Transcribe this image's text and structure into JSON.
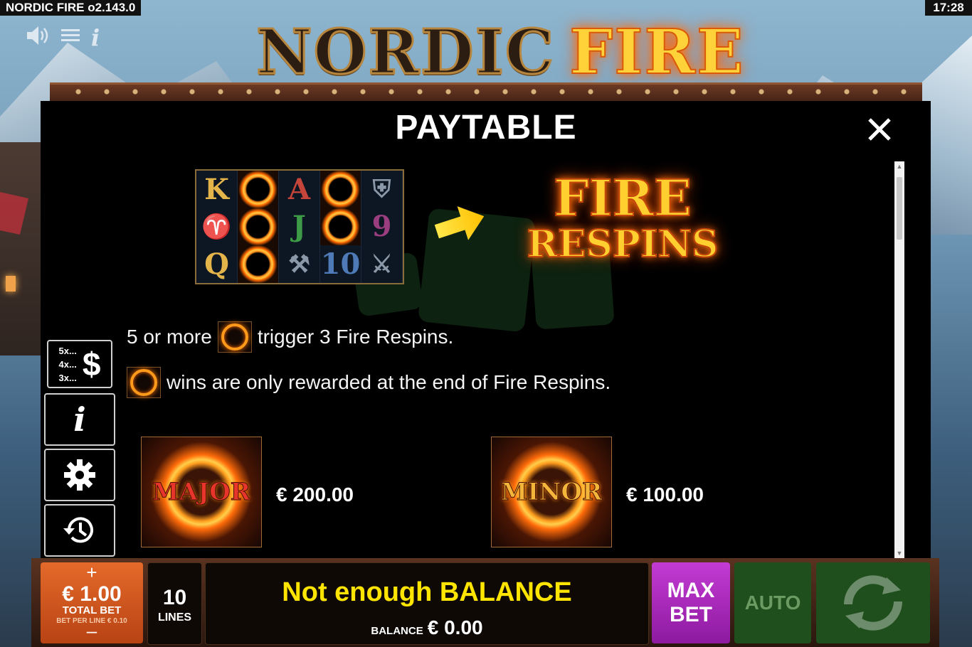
{
  "header": {
    "app_title": "NORDIC FIRE  o2.143.0",
    "clock": "17:28"
  },
  "logo": {
    "word1": "NORDIC",
    "word2": "FIRE"
  },
  "top_icons": [
    "speaker-icon",
    "menu-icon",
    "info-icon"
  ],
  "paytable": {
    "title": "PAYTABLE",
    "reels": [
      [
        "K",
        "ring",
        "A",
        "ring",
        "helmet"
      ],
      [
        "horn",
        "ring",
        "J",
        "ring",
        "9"
      ],
      [
        "Q",
        "ring",
        "hammer",
        "10",
        "viking"
      ]
    ],
    "feature": {
      "line1": "FIRE",
      "line2": "RESPINS"
    },
    "info_prefix": "5 or more",
    "info_suffix": "trigger 3 Fire Respins.",
    "info2": "wins are only rewarded at the end of Fire Respins.",
    "jackpots": [
      {
        "label": "MAJOR",
        "value": "€ 200.00"
      },
      {
        "label": "MINOR",
        "value": "€ 100.00"
      }
    ]
  },
  "side_menu": {
    "paytable_rows": [
      "5x...",
      "4x...",
      "3x..."
    ],
    "paytable_symbol": "$"
  },
  "bottom": {
    "bet_amount": "€ 1.00",
    "bet_label": "TOTAL BET",
    "bet_per_line": "BET PER LINE € 0.10",
    "lines_count": "10",
    "lines_label": "LINES",
    "message": "Not enough BALANCE",
    "balance_label": "BALANCE",
    "balance_value": "€ 0.00",
    "max_bet_line1": "MAX",
    "max_bet_line2": "BET",
    "auto_label": "AUTO"
  },
  "colors": {
    "accent_orange": "#e46a2a",
    "max_bet_purple": "#c33bd3",
    "auto_green": "#1f4f1c",
    "message_yellow": "#ffe500"
  }
}
